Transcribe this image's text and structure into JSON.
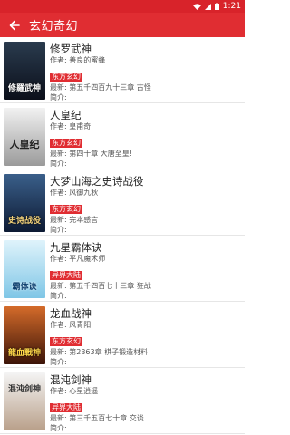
{
  "status": {
    "time": "1:21"
  },
  "header": {
    "title": "玄幻奇幻"
  },
  "books": [
    {
      "title": "修罗武神",
      "author": "作者: 善良的蜜蜂",
      "tag": "东方玄幻",
      "latest": "最新: 第五千四百九十三章 古怪",
      "intro": "简介:",
      "cover_text": "修羅武神",
      "cover_top": "#2a3b4e",
      "cover_bottom": "#0b0f1a"
    },
    {
      "title": "人皇纪",
      "author": "作者: 皇甫奇",
      "tag": "东方玄幻",
      "latest": "最新: 第四十章 大唐至皇!",
      "intro": "简介:",
      "cover_text": "人皇纪",
      "cover_top": "#f2f2f2",
      "cover_bottom": "#9a9a9a"
    },
    {
      "title": "大梦山海之史诗战役",
      "author": "作者: 风御九秋",
      "tag": "东方玄幻",
      "latest": "最新: 完本感言",
      "intro": "简介:",
      "cover_text": "史诗战役",
      "cover_top": "#3a5f8a",
      "cover_bottom": "#0d1a33"
    },
    {
      "title": "九星霸体诀",
      "author": "作者: 平凡魔术师",
      "tag": "异界大陆",
      "latest": "最新: 第五千四百七十三章 狂战",
      "intro": "简介:",
      "cover_text": "霸体诀",
      "cover_top": "#dff3fb",
      "cover_bottom": "#7fc6e6"
    },
    {
      "title": "龙血战神",
      "author": "作者: 风青阳",
      "tag": "东方玄幻",
      "latest": "最新: 第2363章 棋子锻造材料",
      "intro": "简介:",
      "cover_text": "龍血戰神",
      "cover_top": "#d46b2a",
      "cover_bottom": "#3b1408"
    },
    {
      "title": "混沌剑神",
      "author": "作者: 心星逍遥",
      "tag": "异界大陆",
      "latest": "最新: 第三千五百七十章 交谈",
      "intro": "简介:",
      "cover_text": "混沌剑神",
      "cover_top": "#f4f4f4",
      "cover_bottom": "#b9a08a"
    }
  ]
}
